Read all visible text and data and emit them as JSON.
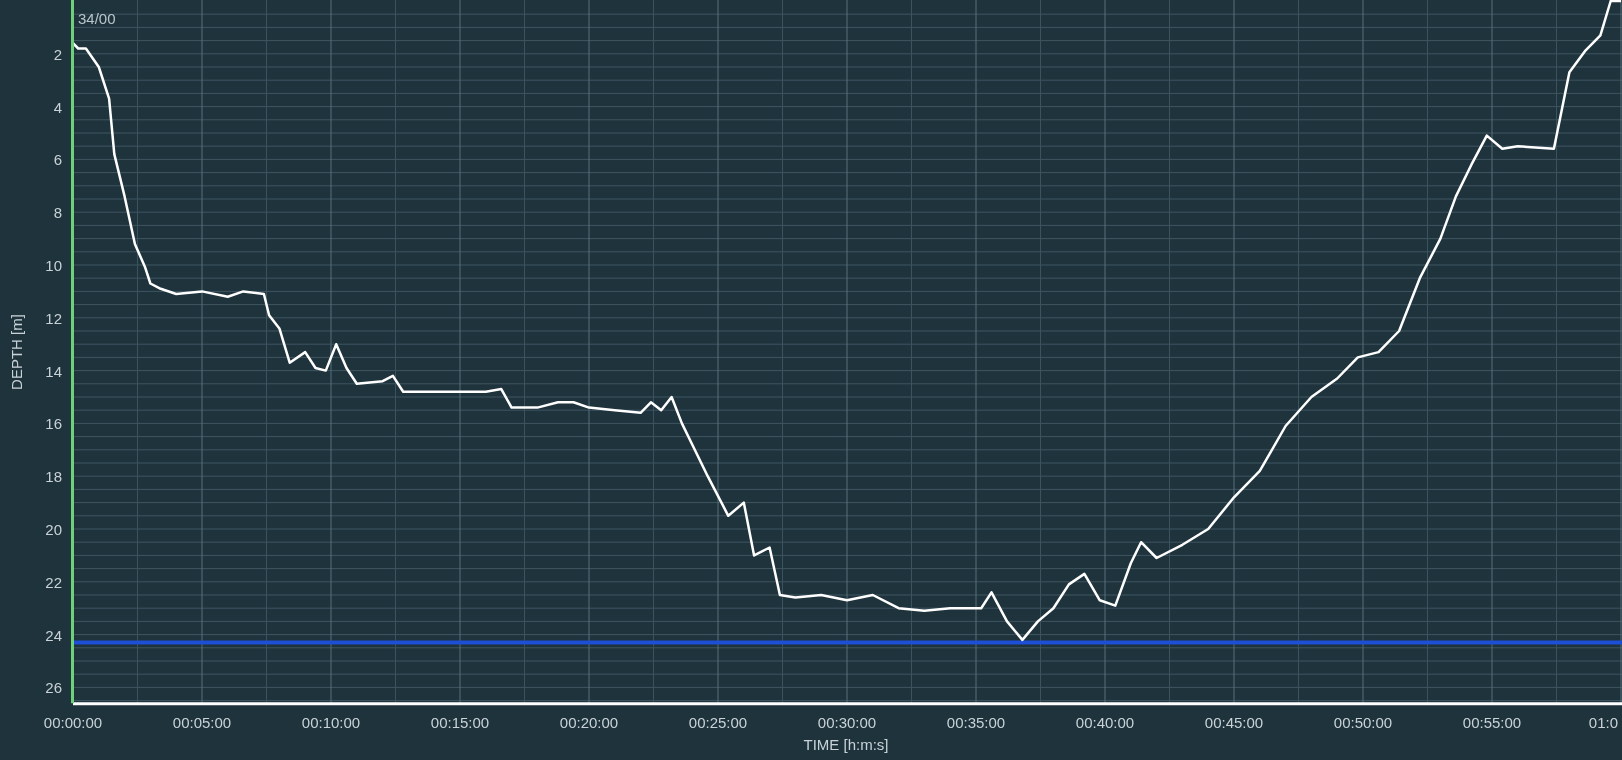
{
  "chart_data": {
    "type": "line",
    "xlabel": "TIME [h:m:s]",
    "ylabel": "DEPTH [m]",
    "xlim": [
      0,
      60
    ],
    "ylim": [
      26.6,
      0
    ],
    "xticks": [
      {
        "value": 0,
        "label": "00:00:00"
      },
      {
        "value": 5,
        "label": "00:05:00"
      },
      {
        "value": 10,
        "label": "00:10:00"
      },
      {
        "value": 15,
        "label": "00:15:00"
      },
      {
        "value": 20,
        "label": "00:20:00"
      },
      {
        "value": 25,
        "label": "00:25:00"
      },
      {
        "value": 30,
        "label": "00:30:00"
      },
      {
        "value": 35,
        "label": "00:35:00"
      },
      {
        "value": 40,
        "label": "00:40:00"
      },
      {
        "value": 45,
        "label": "00:45:00"
      },
      {
        "value": 50,
        "label": "00:50:00"
      },
      {
        "value": 55,
        "label": "00:55:00"
      },
      {
        "value": 60,
        "label": "01:0"
      }
    ],
    "yticks": [
      2,
      4,
      6,
      8,
      10,
      12,
      14,
      16,
      18,
      20,
      22,
      24,
      26
    ],
    "x": [
      0,
      0.2,
      0.5,
      1,
      1.4,
      1.6,
      2,
      2.4,
      2.8,
      3,
      3.4,
      4,
      5,
      6,
      6.6,
      7.4,
      7.6,
      8,
      8.4,
      9,
      9.4,
      9.8,
      10.2,
      10.6,
      11,
      12,
      12.4,
      12.8,
      14,
      16,
      16.6,
      17,
      18,
      18.8,
      19.4,
      20,
      21,
      22,
      22.4,
      22.8,
      23.2,
      23.6,
      24,
      24.6,
      25.4,
      26,
      26.4,
      27,
      27.4,
      28,
      29,
      30,
      31,
      32,
      33,
      34,
      35.2,
      35.6,
      36.2,
      36.8,
      37.4,
      38,
      38.6,
      39.2,
      39.8,
      40.4,
      41,
      41.4,
      42,
      43,
      44,
      45,
      46,
      47,
      48,
      49,
      49.8,
      50.6,
      51.4,
      52.2,
      53,
      53.6,
      54.2,
      54.8,
      55.4,
      56,
      57.4,
      58,
      58.6,
      59.2,
      59.6,
      60
    ],
    "series": [
      {
        "color": "#ffffff",
        "values": [
          1.6,
          1.8,
          1.8,
          2.5,
          3.7,
          5.8,
          7.4,
          9.2,
          10.1,
          10.7,
          10.9,
          11.1,
          11.0,
          11.2,
          11.0,
          11.1,
          11.9,
          12.4,
          13.7,
          13.3,
          13.9,
          14.0,
          13.0,
          13.9,
          14.5,
          14.4,
          14.2,
          14.8,
          14.8,
          14.8,
          14.7,
          15.4,
          15.4,
          15.2,
          15.2,
          15.4,
          15.5,
          15.6,
          15.2,
          15.5,
          15.0,
          16.0,
          16.8,
          18.0,
          19.5,
          19.0,
          21.0,
          20.7,
          22.5,
          22.6,
          22.5,
          22.7,
          22.5,
          23.0,
          23.1,
          23.0,
          23.0,
          22.4,
          23.5,
          24.2,
          23.5,
          23.0,
          22.1,
          21.7,
          22.7,
          22.9,
          21.3,
          20.5,
          21.1,
          20.6,
          20.0,
          18.8,
          17.8,
          16.1,
          15.0,
          14.3,
          13.5,
          13.3,
          12.5,
          10.5,
          9.0,
          7.4,
          6.2,
          5.1,
          5.6,
          5.5,
          5.6,
          2.7,
          1.9,
          1.3,
          0,
          0
        ]
      }
    ],
    "ref_lines": [
      {
        "axis": "y",
        "value": 24.3
      }
    ],
    "grid": true,
    "annotations": [
      "34/00"
    ]
  }
}
